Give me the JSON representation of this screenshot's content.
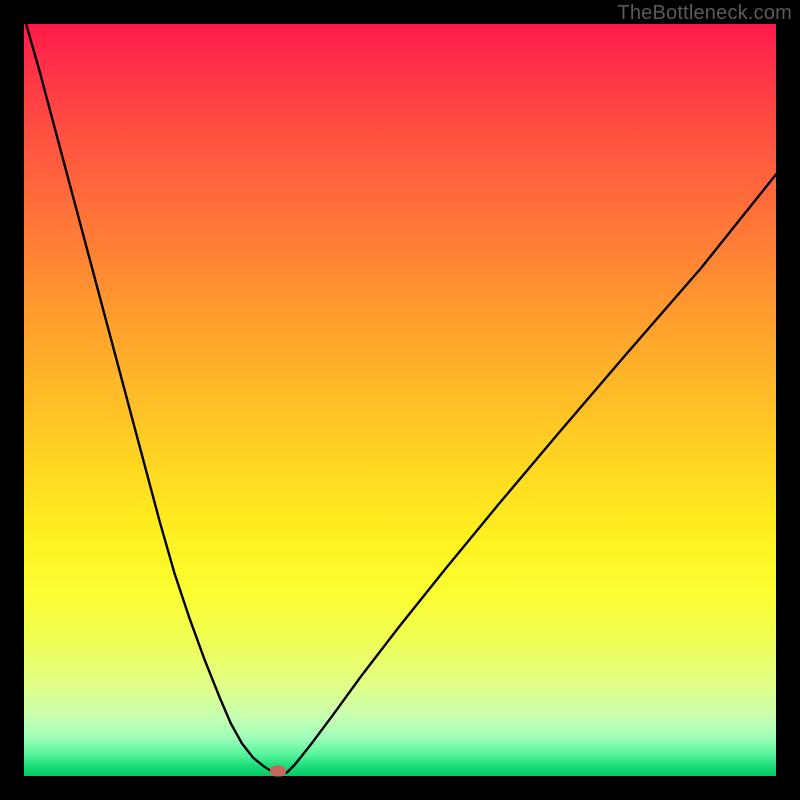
{
  "watermark": "TheBottleneck.com",
  "colors": {
    "frame": "#000000",
    "gradient_top": "#ff1a4a",
    "gradient_bottom": "#00c861",
    "curve": "#000000",
    "marker": "#c1695a"
  },
  "chart_data": {
    "type": "line",
    "title": "",
    "xlabel": "",
    "ylabel": "",
    "xlim": [
      0,
      100
    ],
    "ylim": [
      0,
      100
    ],
    "x": [
      0,
      2,
      4,
      6,
      8,
      10,
      12,
      14,
      16,
      18,
      20,
      22,
      24,
      26,
      27.5,
      29,
      30.5,
      32,
      33,
      33.8,
      34.4,
      35,
      36,
      38,
      41,
      45,
      50,
      56,
      63,
      71,
      80,
      90,
      100
    ],
    "y": [
      101,
      94,
      86.5,
      79,
      71.5,
      64,
      56.5,
      49,
      41.5,
      34,
      27,
      21,
      15.5,
      10.5,
      7,
      4.3,
      2.4,
      1.2,
      0.6,
      0.4,
      0.3,
      0.5,
      1.5,
      4,
      8,
      13.5,
      20,
      27.5,
      36,
      45.5,
      56,
      67.5,
      80
    ],
    "marker": {
      "x": 33.8,
      "y": 0.6
    },
    "notes": "Axes and ticks are not displayed; values are normalized 0–100 as a fraction of the plot area width/height. The curve resembles |x − x0| shaped bottleneck with minimum near x≈34%."
  }
}
